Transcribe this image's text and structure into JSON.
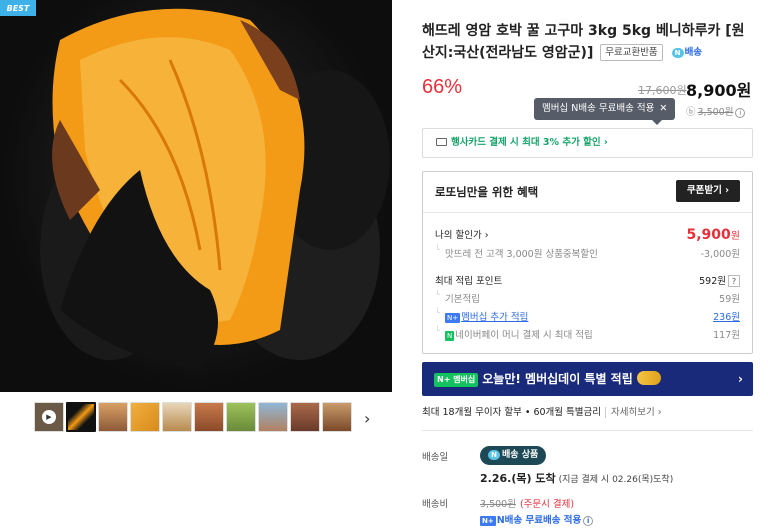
{
  "product_image": {
    "badge": "BEST"
  },
  "thumbnails": {
    "count": 10,
    "active_index": 1,
    "next_icon": "chevron-right-icon"
  },
  "product": {
    "title": "해뜨레 영암 호박 꿀 고구마 3kg 5kg 베니하루카 [원산지:국산(전라남도 영암군)]",
    "tag_return": "무료교환반품",
    "tag_delivery": "배송",
    "discount_rate": "66%",
    "original_price": "17,600원",
    "final_price": "8,900원"
  },
  "tooltip": {
    "text": "멤버십 N배송 무료배송 적용",
    "close": "✕"
  },
  "shipping_strike": {
    "prefix": "ⓑ",
    "amount": "3,500원"
  },
  "card_promo": {
    "text": "행사카드 결제 시 최대 3% 추가 할인 ›"
  },
  "benefit": {
    "heading": "로또님만을 위한 혜택",
    "coupon_button": "쿠폰받기 ›",
    "my_price_label": "나의 할인가 ›",
    "my_price_value": "5,900",
    "my_price_unit": "원",
    "sub_discount_label": "맛뜨레 전 고객 3,000원 상품중복할인",
    "sub_discount_value": "-3,000원",
    "max_point_label": "최대 적립 포인트",
    "max_point_value": "592원",
    "help": "?",
    "basic_label": "기본적립",
    "basic_value": "59원",
    "membership_label": "멤버십 추가 적립",
    "membership_value": "236원",
    "membership_badge": "N+",
    "npay_label": "네이버페이 머니 결제 시 최대 적립",
    "npay_value": "117원",
    "npay_badge": "N"
  },
  "banner": {
    "badge": "N+ 멤버십",
    "text": "오늘만! 멤버십데이 특별 적립",
    "chevron": "›"
  },
  "installment": {
    "text": "최대 18개월 무이자 할부 • 60개월 특별금리",
    "more": "자세히보기 ›"
  },
  "delivery": {
    "date_label": "배송일",
    "chip": "배송 상품",
    "arrival": "2.26.(목) 도착",
    "arrival_note": "(지금 결제 시 02.26(목)도착)",
    "fee_label": "배송비",
    "fee_original": "3,500원",
    "fee_note": "(주문시 결제)",
    "free_text": "N배송 무료배송 적용",
    "free_badge": "N+"
  }
}
